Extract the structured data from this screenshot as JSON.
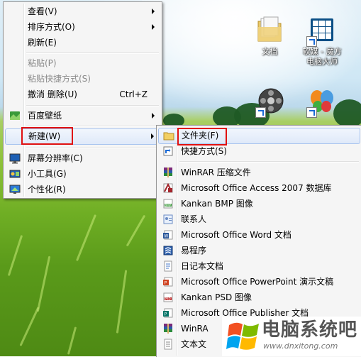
{
  "desktop": {
    "icons": [
      {
        "label": "文档"
      },
      {
        "label_line1": "软媒 - 魔方"
      },
      {
        "label_line2": "电脑大师"
      }
    ]
  },
  "context_menu": {
    "items": [
      {
        "label": "查看(V)",
        "submenu": true
      },
      {
        "label": "排序方式(O)",
        "submenu": true
      },
      {
        "label": "刷新(E)"
      },
      {
        "label": "粘贴(P)",
        "disabled": true
      },
      {
        "label": "粘贴快捷方式(S)",
        "disabled": true
      },
      {
        "label": "撤消 删除(U)",
        "shortcut": "Ctrl+Z"
      },
      {
        "label": "百度壁纸",
        "submenu": true,
        "icon": "baidu-wallpaper-icon"
      },
      {
        "label": "新建(W)",
        "submenu": true,
        "highlighted": true
      },
      {
        "label": "屏幕分辨率(C)",
        "icon": "screen-resolution-icon"
      },
      {
        "label": "小工具(G)",
        "icon": "gadgets-icon"
      },
      {
        "label": "个性化(R)",
        "icon": "personalize-icon"
      }
    ]
  },
  "new_submenu": {
    "items": [
      {
        "label": "文件夹(F)",
        "icon": "folder-icon",
        "highlighted": true
      },
      {
        "label": "快捷方式(S)",
        "icon": "shortcut-icon"
      },
      {
        "label": "WinRAR 压缩文件",
        "icon": "winrar-icon"
      },
      {
        "label": "Microsoft Office Access 2007 数据库",
        "icon": "access-icon"
      },
      {
        "label": "Kankan BMP 图像",
        "icon": "bmp-icon"
      },
      {
        "label": "联系人",
        "icon": "contact-icon"
      },
      {
        "label": "Microsoft Office Word 文档",
        "icon": "word-icon"
      },
      {
        "label": "易程序",
        "icon": "e-program-icon"
      },
      {
        "label": "日记本文档",
        "icon": "journal-icon"
      },
      {
        "label": "Microsoft Office PowerPoint 演示文稿",
        "icon": "powerpoint-icon"
      },
      {
        "label": "Kankan PSD 图像",
        "icon": "psd-icon"
      },
      {
        "label": "Microsoft Office Publisher 文档",
        "icon": "publisher-icon"
      },
      {
        "label": "WinRA",
        "icon": "winrar-icon"
      },
      {
        "label": "文本文",
        "icon": "text-icon"
      }
    ]
  },
  "watermark": {
    "title": "电脑系统吧",
    "url": "www.dnxitong.com"
  },
  "colors": {
    "highlight_box": "#e01010",
    "menu_bg": "#f5f5f5"
  }
}
